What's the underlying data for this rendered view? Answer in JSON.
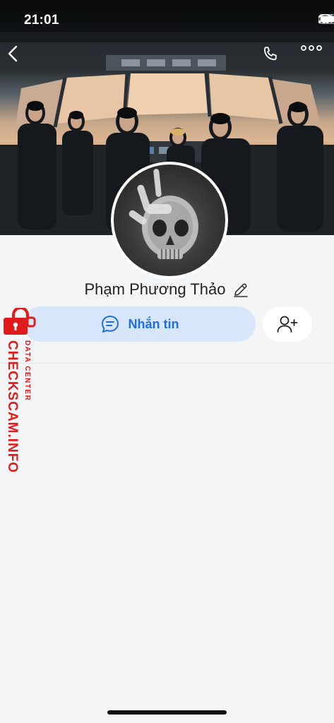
{
  "status_bar": {
    "time": "21:01"
  },
  "profile": {
    "name": "Phạm Phương Thảo"
  },
  "actions": {
    "message_label": "Nhắn tin"
  },
  "watermark": {
    "main": "CHECKSCAM.INFO",
    "sub": "DATA CENTER"
  },
  "icons": {
    "back": "chevron-left-icon",
    "call": "phone-icon",
    "more": "more-horizontal-icon",
    "edit": "pencil-icon",
    "chat": "chat-bubble-icon",
    "add_friend": "add-user-icon",
    "lock": "lock-icon"
  },
  "colors": {
    "accent": "#1f6ee8",
    "message_button_bg": "#d8e6fb",
    "watermark": "#e11b1b",
    "background": "#f4f5f7"
  }
}
